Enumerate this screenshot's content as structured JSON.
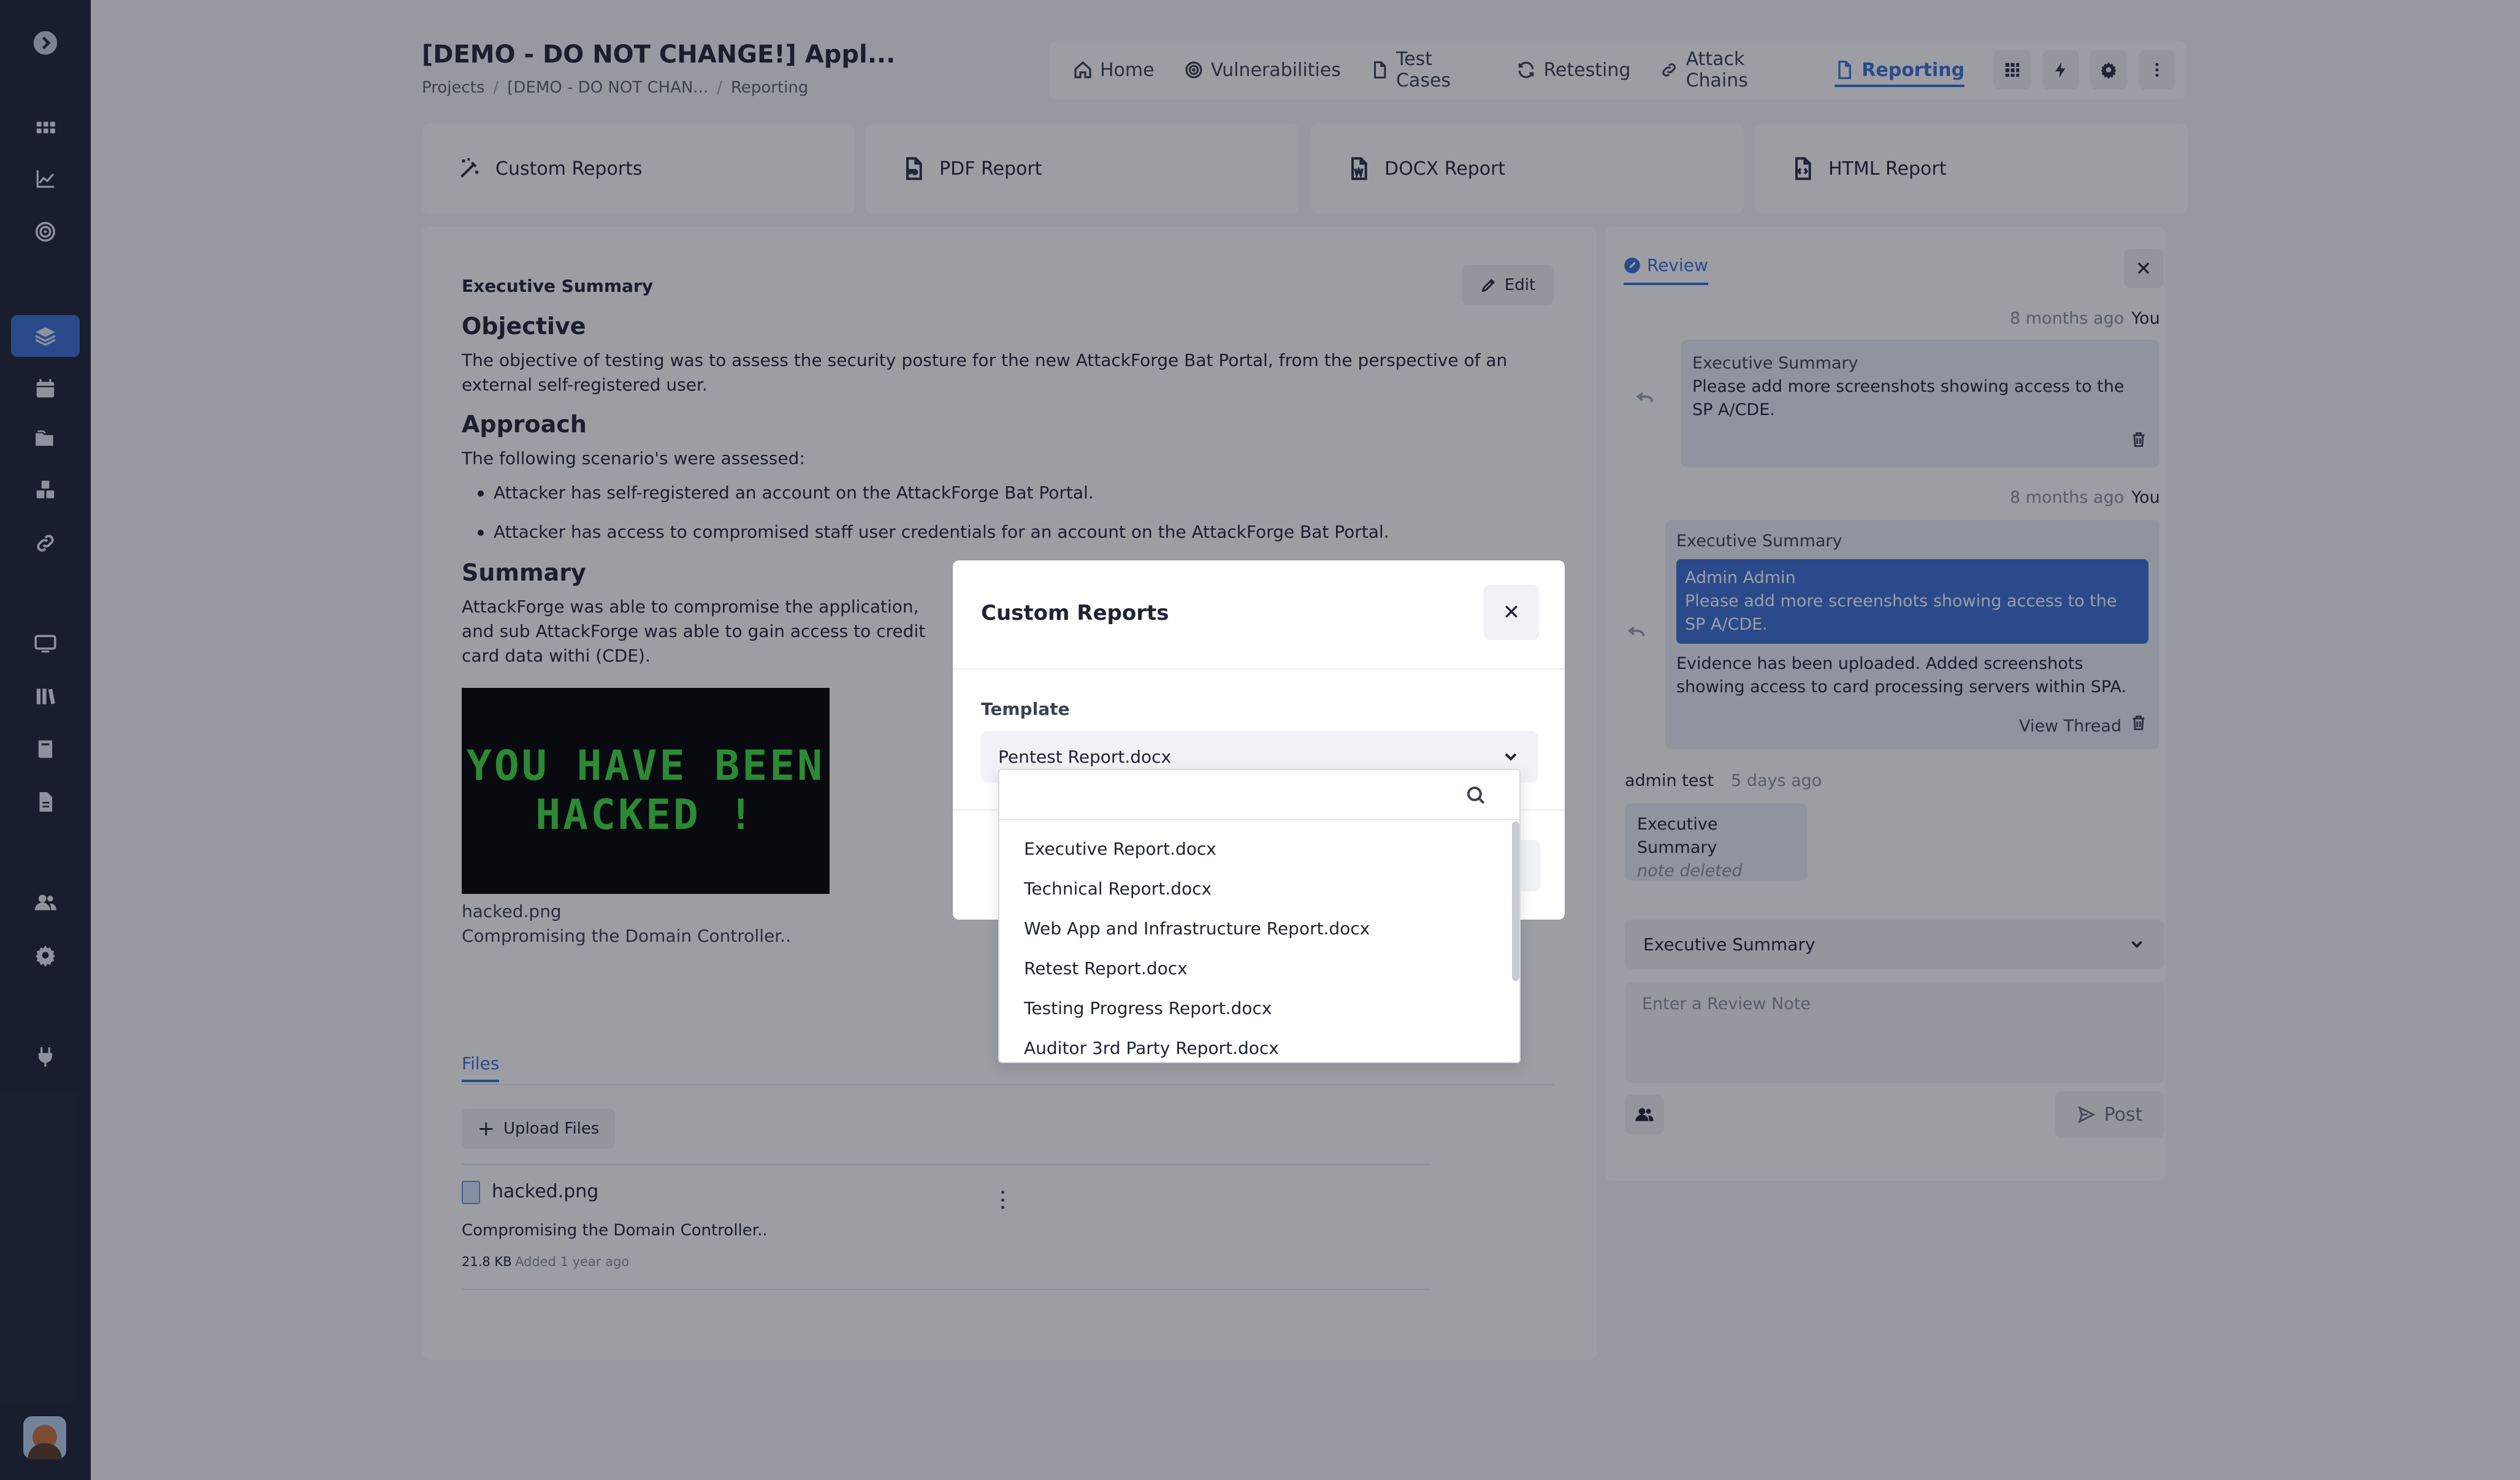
{
  "header": {
    "project_title": "[DEMO - DO NOT CHANGE!] Appl...",
    "breadcrumb": [
      "Projects",
      "[DEMO - DO NOT CHAN...",
      "Reporting"
    ]
  },
  "nav": {
    "tabs": [
      {
        "label": "Home",
        "icon": "home-icon"
      },
      {
        "label": "Vulnerabilities",
        "icon": "target-icon"
      },
      {
        "label": "Test Cases",
        "icon": "file-icon"
      },
      {
        "label": "Retesting",
        "icon": "refresh-icon"
      },
      {
        "label": "Attack Chains",
        "icon": "link-icon"
      },
      {
        "label": "Reporting",
        "icon": "document-icon",
        "active": true
      }
    ],
    "icon_buttons": [
      "grid-icon",
      "bolt-icon",
      "gear-icon",
      "more-vertical-icon"
    ]
  },
  "report_types": [
    {
      "label": "Custom Reports",
      "icon": "magic-wand-icon"
    },
    {
      "label": "PDF Report",
      "icon": "pdf-file-icon"
    },
    {
      "label": "DOCX Report",
      "icon": "docx-file-icon"
    },
    {
      "label": "HTML Report",
      "icon": "html-file-icon"
    }
  ],
  "main": {
    "section_title": "Executive Summary",
    "edit_label": "Edit",
    "objective_heading": "Objective",
    "objective_text": "The objective of testing was to assess the security posture for the new AttackForge Bat Portal, from the perspective of an external self-registered user.",
    "approach_heading": "Approach",
    "approach_intro": "The following scenario's were assessed:",
    "approach_items": [
      "Attacker has self-registered an account on the AttackForge Bat Portal.",
      "Attacker has access to compromised staff user credentials for an account on the AttackForge Bat Portal."
    ],
    "summary_heading": "Summary",
    "summary_text": "AttackForge was able to compromise the application, and sub AttackForge was able to gain access to credit card data withi (CDE).",
    "image_text_line1": "YOU HAVE BEEN",
    "image_text_line2": "HACKED !",
    "image_name": "hacked.png",
    "image_caption": "Compromising the Domain Controller..",
    "files_tab": "Files",
    "upload_label": "Upload Files",
    "file": {
      "name": "hacked.png",
      "description": "Compromising the Domain Controller..",
      "size": "21.8 KB",
      "added": "Added 1 year ago"
    }
  },
  "review": {
    "tab_label": "Review",
    "comments": [
      {
        "time": "8 months ago",
        "author": "You",
        "title": "Executive Summary",
        "text": "Please add more screenshots showing access to the SP A/CDE."
      },
      {
        "time": "8 months ago",
        "author": "You",
        "title": "Executive Summary",
        "quote_author": "Admin Admin",
        "quote_text": "Please add more screenshots showing access to the SP A/CDE.",
        "text": "Evidence has been uploaded. Added screenshots showing access to card processing servers within SPA.",
        "view_thread": "View Thread"
      },
      {
        "author": "admin test",
        "time": "5 days ago",
        "title": "Executive Summary",
        "text": "note deleted"
      }
    ],
    "section_select": "Executive Summary",
    "note_placeholder": "Enter a Review Note",
    "post_label": "Post"
  },
  "modal": {
    "title": "Custom Reports",
    "template_label": "Template",
    "selected_template": "Pentest Report.docx",
    "search_value": "",
    "options": [
      "Executive Report.docx",
      "Technical Report.docx",
      "Web App and Infrastructure Report.docx",
      "Retest Report.docx",
      "Testing Progress Report.docx",
      "Auditor 3rd Party Report.docx"
    ]
  },
  "colors": {
    "sidebar_bg": "#1c2434",
    "accent": "#3b6fd4",
    "page_bg": "#f7f7f9"
  }
}
